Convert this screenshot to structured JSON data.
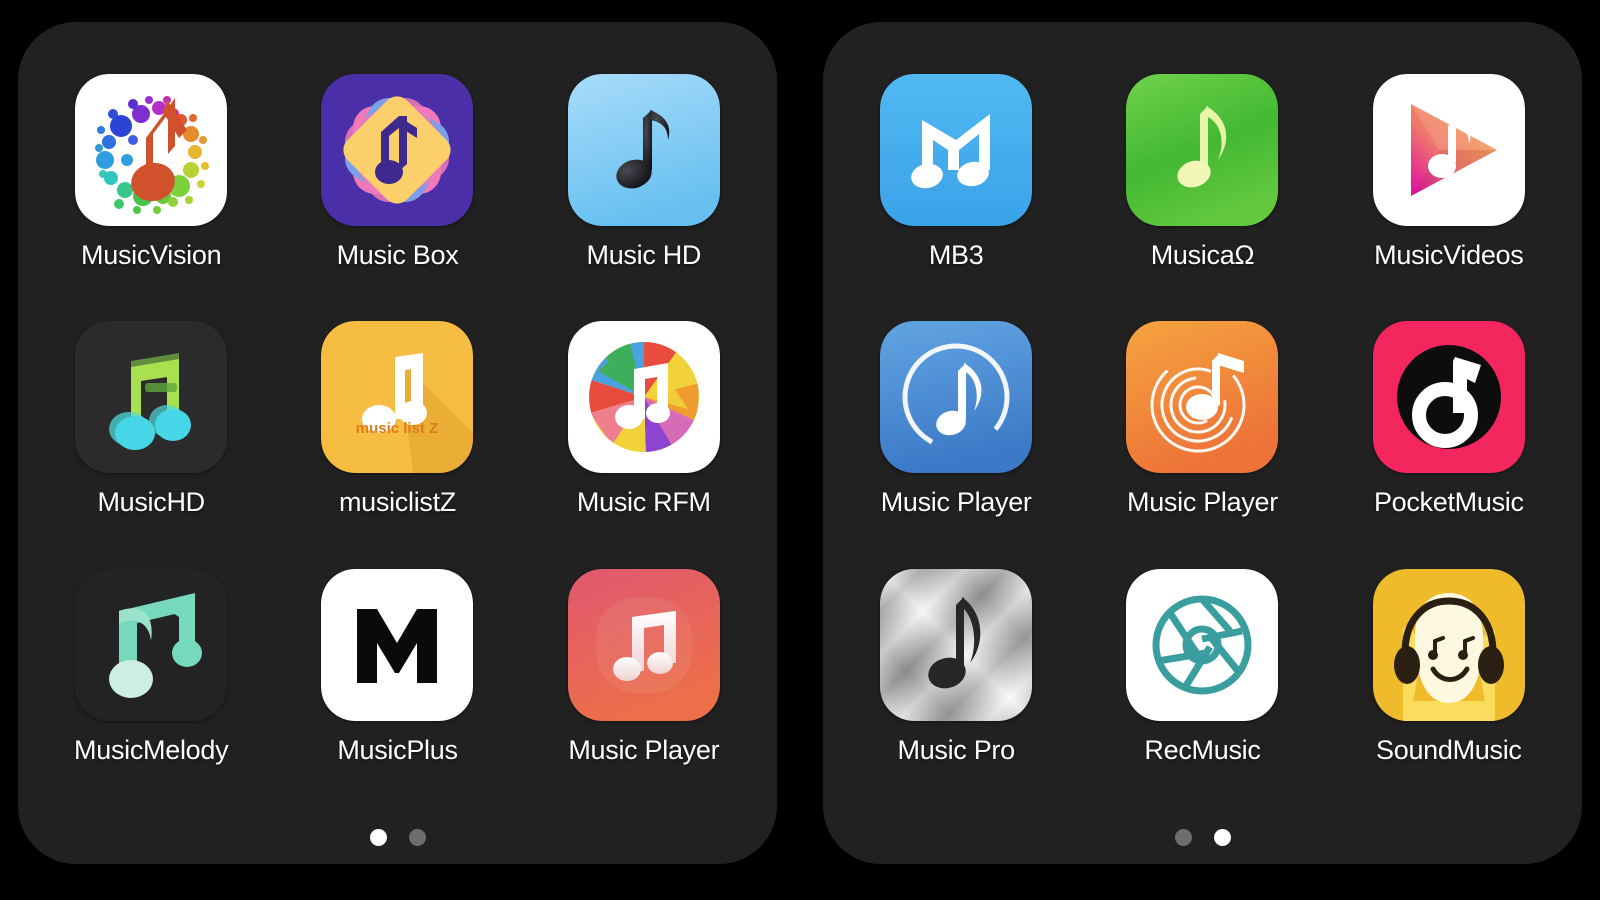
{
  "screen": {
    "background_color": "#000000",
    "panel_color": "#212121",
    "label_color": "#ffffff",
    "dot_active_color": "#ffffff",
    "dot_inactive_color": "#6e6e6e"
  },
  "folders": [
    {
      "name": "music-folder-left",
      "apps": [
        {
          "label": "MusicVision",
          "icon": "musicvision-icon",
          "bg": "#ffffff"
        },
        {
          "label": "Music Box",
          "icon": "music-box-icon",
          "bg": "#4b2fa8"
        },
        {
          "label": "Music HD",
          "icon": "music-hd-icon",
          "bg": "#93d5f6"
        },
        {
          "label": "MusicHD",
          "icon": "musichd-icon",
          "bg": "#2a2a2a"
        },
        {
          "label": "musiclistZ",
          "icon": "musiclistz-icon",
          "bg": "#f5bd42",
          "inner_text": "music list Z"
        },
        {
          "label": "Music RFM",
          "icon": "music-rfm-icon",
          "bg": "#ffffff"
        },
        {
          "label": "MusicMelody",
          "icon": "musicmelody-icon",
          "bg": "#232323"
        },
        {
          "label": "MusicPlus",
          "icon": "musicplus-icon",
          "bg": "#ffffff"
        },
        {
          "label": "Music Player",
          "icon": "music-player-red-icon",
          "bg": "#e05a63"
        }
      ],
      "pages": {
        "count": 2,
        "active_index": 0
      }
    },
    {
      "name": "music-folder-right",
      "apps": [
        {
          "label": "MB3",
          "icon": "mb3-icon",
          "bg": "#3ba6ec"
        },
        {
          "label": "MusicaΩ",
          "icon": "musica-omega-icon",
          "bg": "#4cbb35"
        },
        {
          "label": "MusicVideos",
          "icon": "musicvideos-icon",
          "bg": "#ffffff"
        },
        {
          "label": "Music Player",
          "icon": "music-player-blue-icon",
          "bg": "#4a8fd6"
        },
        {
          "label": "Music Player",
          "icon": "music-player-orange-icon",
          "bg": "#f0923a"
        },
        {
          "label": "PocketMusic",
          "icon": "pocketmusic-icon",
          "bg": "#f4265e"
        },
        {
          "label": "Music Pro",
          "icon": "music-pro-icon",
          "bg": "#c9c9c9"
        },
        {
          "label": "RecMusic",
          "icon": "recmusic-icon",
          "bg": "#ffffff"
        },
        {
          "label": "SoundMusic",
          "icon": "soundmusic-icon",
          "bg": "#f3c134"
        }
      ],
      "pages": {
        "count": 2,
        "active_index": 1
      }
    }
  ]
}
